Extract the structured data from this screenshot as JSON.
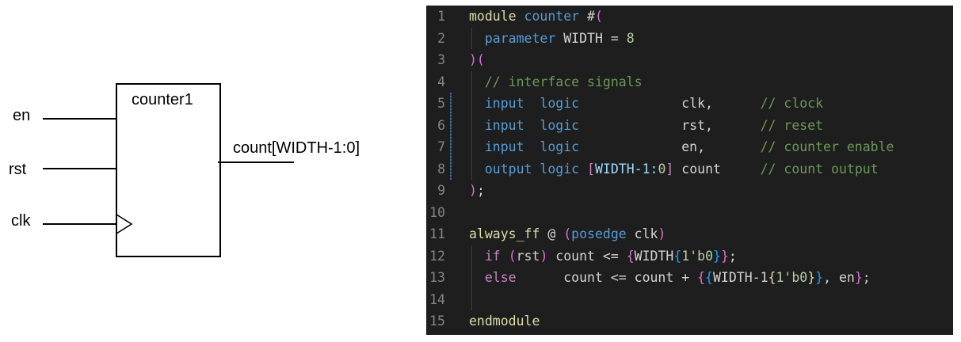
{
  "diagram": {
    "block_name": "counter1",
    "inputs": [
      "en",
      "rst",
      "clk"
    ],
    "output": "count[WIDTH-1:0]"
  },
  "editor": {
    "colors": {
      "background": "#1e1e1e",
      "line_number": "#858585",
      "keyword_module": "#dcdcaa",
      "identifier": "#569cd6",
      "keyword_control": "#c586c0",
      "comment": "#6a9955",
      "number": "#b5cea8",
      "text": "#d4d4d4"
    },
    "lines": [
      {
        "num": "1",
        "tokens": [
          {
            "t": "module",
            "c": "t-yellow"
          },
          {
            "t": " ",
            "c": "t-plain"
          },
          {
            "t": "counter",
            "c": "t-blue"
          },
          {
            "t": " #",
            "c": "t-plain"
          },
          {
            "t": "(",
            "c": "t-orchid"
          }
        ]
      },
      {
        "num": "2",
        "tokens": [
          {
            "t": "  ",
            "c": "t-plain"
          },
          {
            "t": "parameter",
            "c": "t-blue"
          },
          {
            "t": " WIDTH = ",
            "c": "t-plain"
          },
          {
            "t": "8",
            "c": "t-num"
          }
        ]
      },
      {
        "num": "3",
        "tokens": [
          {
            "t": ")(",
            "c": "t-orchid"
          }
        ]
      },
      {
        "num": "4",
        "tokens": [
          {
            "t": "  ",
            "c": "t-plain"
          },
          {
            "t": "// interface signals",
            "c": "t-green"
          }
        ]
      },
      {
        "num": "5",
        "tokens": [
          {
            "t": "  ",
            "c": "t-plain"
          },
          {
            "t": "input",
            "c": "t-blue"
          },
          {
            "t": "  ",
            "c": "t-plain"
          },
          {
            "t": "logic",
            "c": "t-blue"
          },
          {
            "t": "             clk,      ",
            "c": "t-plain"
          },
          {
            "t": "// clock",
            "c": "t-green"
          }
        ]
      },
      {
        "num": "6",
        "tokens": [
          {
            "t": "  ",
            "c": "t-plain"
          },
          {
            "t": "input",
            "c": "t-blue"
          },
          {
            "t": "  ",
            "c": "t-plain"
          },
          {
            "t": "logic",
            "c": "t-blue"
          },
          {
            "t": "             rst,      ",
            "c": "t-plain"
          },
          {
            "t": "// reset",
            "c": "t-green"
          }
        ]
      },
      {
        "num": "7",
        "tokens": [
          {
            "t": "  ",
            "c": "t-plain"
          },
          {
            "t": "input",
            "c": "t-blue"
          },
          {
            "t": "  ",
            "c": "t-plain"
          },
          {
            "t": "logic",
            "c": "t-blue"
          },
          {
            "t": "             en,       ",
            "c": "t-plain"
          },
          {
            "t": "// counter enable",
            "c": "t-green"
          }
        ]
      },
      {
        "num": "8",
        "tokens": [
          {
            "t": "  ",
            "c": "t-plain"
          },
          {
            "t": "output",
            "c": "t-blue"
          },
          {
            "t": " ",
            "c": "t-plain"
          },
          {
            "t": "logic",
            "c": "t-blue"
          },
          {
            "t": " ",
            "c": "t-plain"
          },
          {
            "t": "[",
            "c": "t-purple"
          },
          {
            "t": "WIDTH-1:",
            "c": "t-cyan"
          },
          {
            "t": "0",
            "c": "t-num"
          },
          {
            "t": "]",
            "c": "t-purple"
          },
          {
            "t": " count     ",
            "c": "t-plain"
          },
          {
            "t": "// count output",
            "c": "t-green"
          }
        ]
      },
      {
        "num": "9",
        "tokens": [
          {
            "t": ")",
            "c": "t-orchid"
          },
          {
            "t": ";",
            "c": "t-plain"
          }
        ]
      },
      {
        "num": "10",
        "tokens": []
      },
      {
        "num": "11",
        "tokens": [
          {
            "t": "always_ff",
            "c": "t-yellow"
          },
          {
            "t": " @ ",
            "c": "t-plain"
          },
          {
            "t": "(",
            "c": "t-orchid"
          },
          {
            "t": "posedge",
            "c": "t-blue"
          },
          {
            "t": " clk",
            "c": "t-plain"
          },
          {
            "t": ")",
            "c": "t-orchid"
          }
        ]
      },
      {
        "num": "12",
        "tokens": [
          {
            "t": "  ",
            "c": "t-plain"
          },
          {
            "t": "if",
            "c": "t-purple"
          },
          {
            "t": " ",
            "c": "t-plain"
          },
          {
            "t": "(",
            "c": "t-orchid"
          },
          {
            "t": "rst",
            "c": "t-plain"
          },
          {
            "t": ")",
            "c": "t-orchid"
          },
          {
            "t": " count <= ",
            "c": "t-plain"
          },
          {
            "t": "{",
            "c": "t-orchid"
          },
          {
            "t": "WIDTH",
            "c": "t-plain"
          },
          {
            "t": "{",
            "c": "t-sky"
          },
          {
            "t": "1'b0",
            "c": "t-num"
          },
          {
            "t": "}",
            "c": "t-sky"
          },
          {
            "t": "}",
            "c": "t-orchid"
          },
          {
            "t": ";",
            "c": "t-plain"
          }
        ]
      },
      {
        "num": "13",
        "tokens": [
          {
            "t": "  ",
            "c": "t-plain"
          },
          {
            "t": "else",
            "c": "t-purple"
          },
          {
            "t": "      count <= count + ",
            "c": "t-plain"
          },
          {
            "t": "{",
            "c": "t-orchid"
          },
          {
            "t": "{",
            "c": "t-sky"
          },
          {
            "t": "WIDTH-1",
            "c": "t-plain"
          },
          {
            "t": "{",
            "c": "t-ybr"
          },
          {
            "t": "1'b0",
            "c": "t-num"
          },
          {
            "t": "}",
            "c": "t-ybr"
          },
          {
            "t": "}",
            "c": "t-sky"
          },
          {
            "t": ", en",
            "c": "t-plain"
          },
          {
            "t": "}",
            "c": "t-orchid"
          },
          {
            "t": ";",
            "c": "t-plain"
          }
        ]
      },
      {
        "num": "14",
        "tokens": []
      },
      {
        "num": "15",
        "tokens": [
          {
            "t": "endmodule",
            "c": "t-yellow"
          }
        ]
      }
    ]
  }
}
